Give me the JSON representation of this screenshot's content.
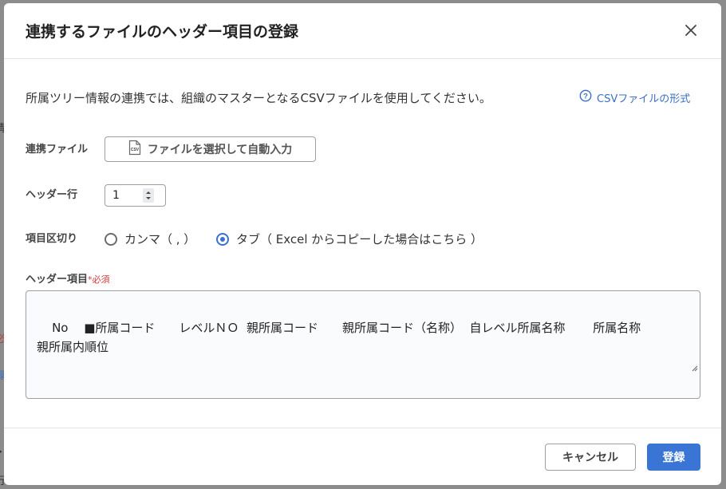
{
  "modal": {
    "title": "連携するファイルのヘッダー項目の登録",
    "description": "所属ツリー情報の連携では、組織のマスターとなるCSVファイルを使用してください。",
    "help_link": "CSVファイルの形式",
    "file": {
      "label": "連携ファイル",
      "button": "ファイルを選択して自動入力",
      "icon_text": "CSV"
    },
    "header_row": {
      "label": "ヘッダー行",
      "value": "1"
    },
    "delimiter": {
      "label": "項目区切り",
      "options": [
        {
          "label": "カンマ（ , ）",
          "checked": false
        },
        {
          "label": "タブ（ Excel からコピーした場合はこちら ）",
          "checked": true
        }
      ]
    },
    "header_items": {
      "label": "ヘッダー項目",
      "required_mark": "*必須",
      "value": "No　 ■所属コード　　レベルＮＯ  親所属コード　　親所属コード（名称）  自レベル所属名称　　 所属名称\n親所属内順位"
    },
    "footer": {
      "cancel": "キャンセル",
      "submit": "登録"
    }
  },
  "background": {
    "fragments": [
      "情",
      "必",
      "録",
      "・",
      "行"
    ]
  },
  "colors": {
    "primary": "#3a74d4",
    "link": "#3a6fc4",
    "required": "#d23a3a"
  }
}
